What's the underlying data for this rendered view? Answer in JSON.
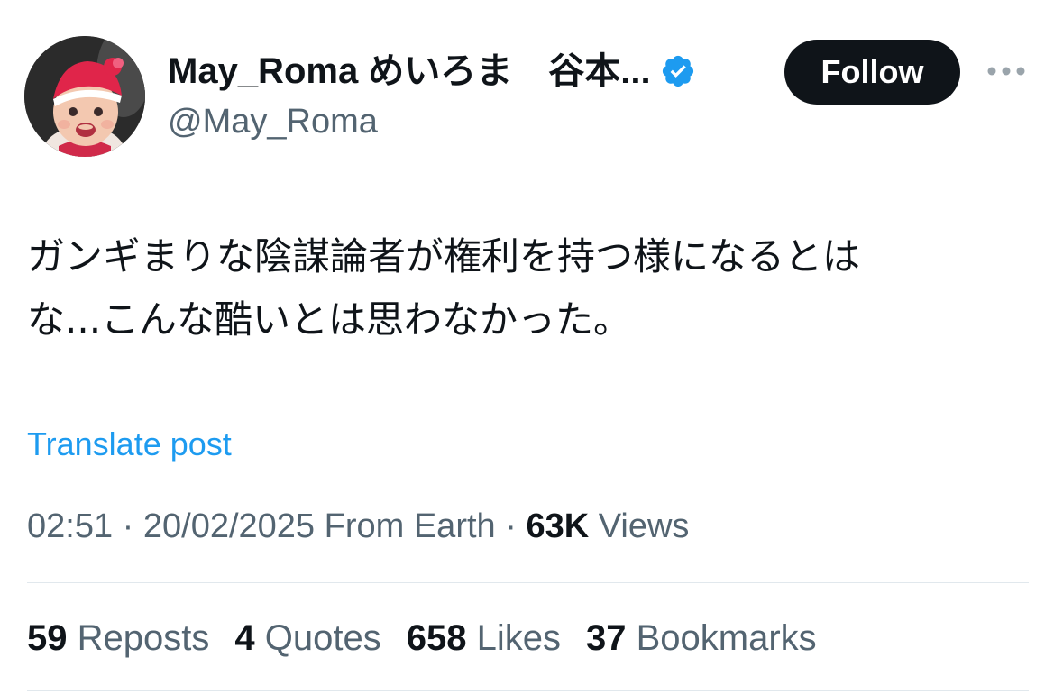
{
  "author": {
    "display_name": "May_Roma めいろま　谷本...",
    "handle": "@May_Roma",
    "verified_icon": "verified-badge-icon",
    "avatar": "baby-photo-avatar"
  },
  "actions": {
    "follow_label": "Follow",
    "more_icon": "more-icon"
  },
  "post": {
    "text_line_1": "ガンギまりな陰謀論者が権利を持つ様になるとは",
    "text_line_2": "な...こんな酷いとは思わなかった。",
    "translate_label": "Translate post"
  },
  "meta": {
    "time": "02:51",
    "separator": " · ",
    "date": "20/02/2025",
    "source": "From Earth",
    "views_count": "63K",
    "views_label": "Views"
  },
  "stats": [
    {
      "count": "59",
      "label": "Reposts"
    },
    {
      "count": "4",
      "label": "Quotes"
    },
    {
      "count": "658",
      "label": "Likes"
    },
    {
      "count": "37",
      "label": "Bookmarks"
    }
  ],
  "colors": {
    "accent": "#1d9bf0",
    "text_primary": "#0f1419",
    "text_secondary": "#536471",
    "follow_bg": "#0f1419"
  }
}
